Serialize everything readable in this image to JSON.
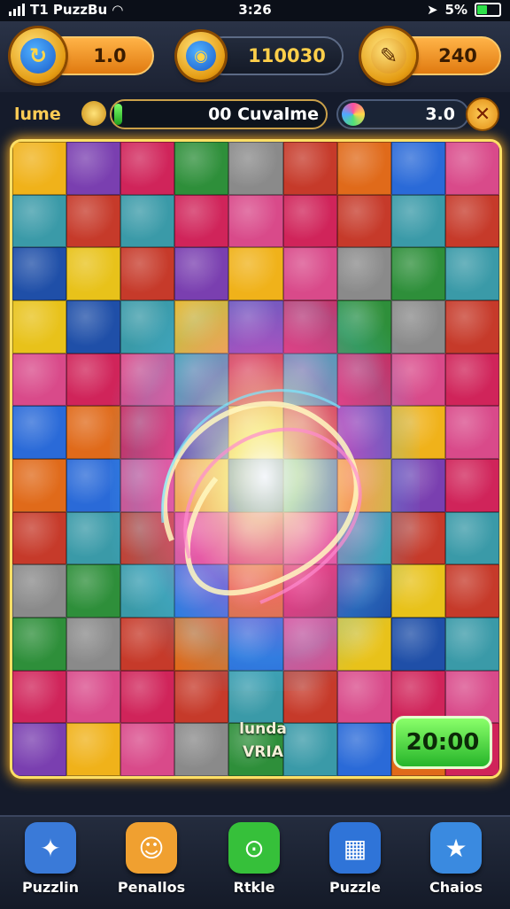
{
  "status_bar": {
    "carrier": "T1 PuzzBu",
    "time": "3:26",
    "battery": "5%",
    "battery_level": 0.5
  },
  "top_bar": {
    "coins_value": "1.0",
    "center_value": "110030",
    "gems_value": "240"
  },
  "progress": {
    "label": "lume",
    "bar_text": "00 Cuvalme",
    "bar_fill": 0.04,
    "score_value": "3.0",
    "close_glyph": "✕"
  },
  "board": {
    "tag_line1": "lunda",
    "tag_line2": "VRIA",
    "timer": "20:00",
    "piece_colors": [
      "#f0b21a",
      "#c63a2a",
      "#1f4fa8",
      "#2e8f3a",
      "#d94a8a",
      "#7a3fb0",
      "#e06a1a",
      "#3a9aa8",
      "#8a8a8a",
      "#e8c21a",
      "#d0245a",
      "#2a6ad8"
    ]
  },
  "nav": {
    "items": [
      {
        "label": "Puzzlin",
        "icon": "wand-icon",
        "color": "#3a7ad8"
      },
      {
        "label": "Penallos",
        "icon": "cat-icon",
        "color": "#f0a030"
      },
      {
        "label": "Rtkle",
        "icon": "magnifier-icon",
        "color": "#36c03a"
      },
      {
        "label": "Puzzle",
        "icon": "puzzle-box-icon",
        "color": "#2f74d8"
      },
      {
        "label": "Chaios",
        "icon": "star-icon",
        "color": "#3a8ae0"
      }
    ]
  }
}
